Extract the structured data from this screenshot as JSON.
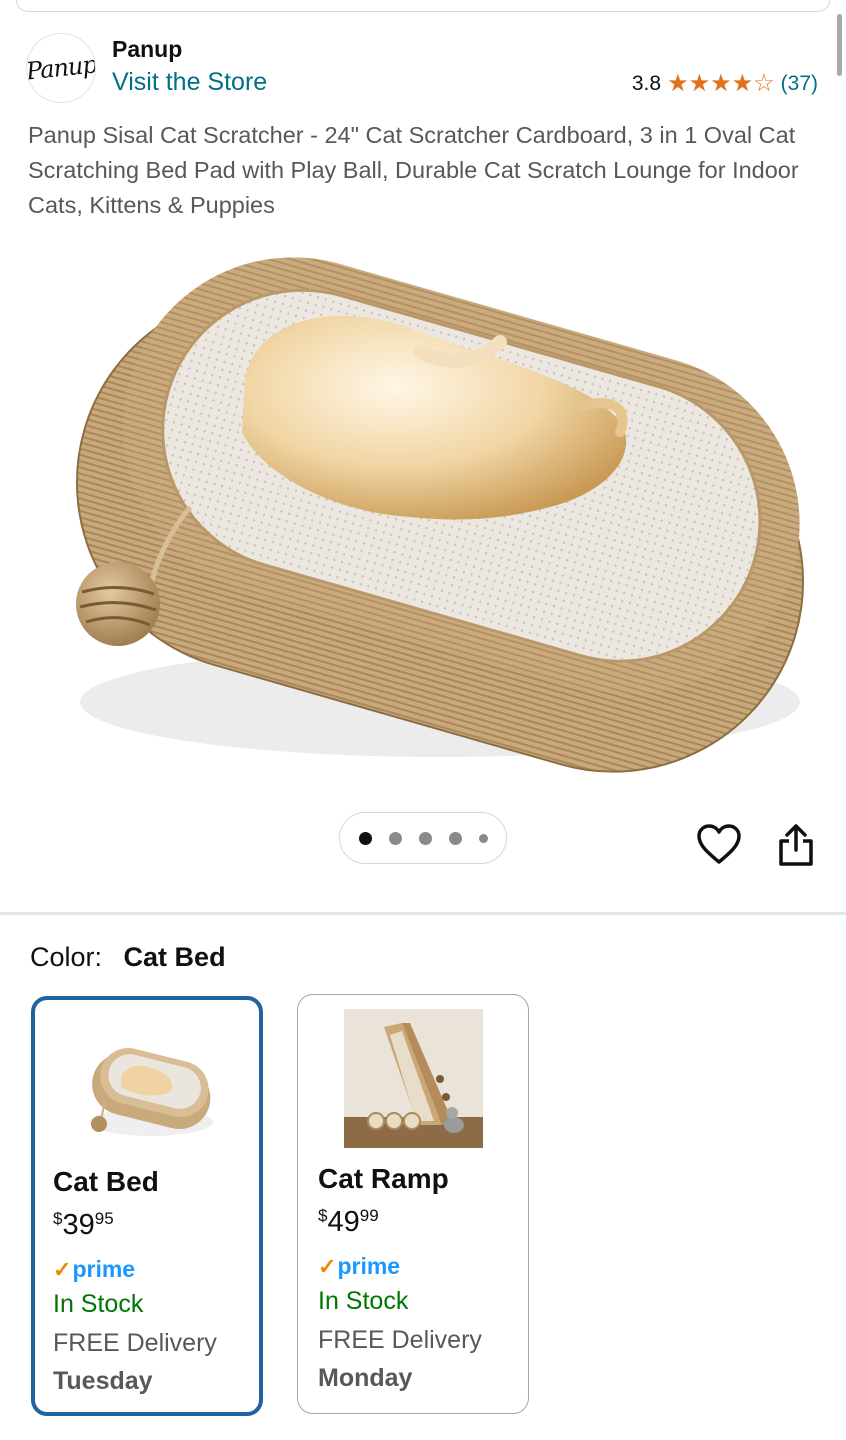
{
  "brand": {
    "logo_text": "Panup",
    "name": "Panup",
    "store_link": "Visit the Store"
  },
  "rating": {
    "value": "3.8",
    "stars": 3.8,
    "count": "(37)"
  },
  "product": {
    "title": "Panup Sisal Cat Scratcher - 24\" Cat Scratcher Cardboard, 3 in 1 Oval Cat Scratching Bed Pad with Play Ball, Durable Cat Scratch Lounge for Indoor Cats, Kittens & Puppies"
  },
  "gallery": {
    "image_count": 5,
    "active_index": 0
  },
  "actions": {
    "heart_icon": "heart-icon",
    "share_icon": "share-icon"
  },
  "variant": {
    "label": "Color:",
    "selected": "Cat Bed",
    "options": [
      {
        "name": "Cat Bed",
        "price_symbol": "$",
        "price_whole": "39",
        "price_cents": "95",
        "prime": "prime",
        "stock": "In Stock",
        "delivery": "FREE Delivery",
        "day": "Tuesday"
      },
      {
        "name": "Cat Ramp",
        "price_symbol": "$",
        "price_whole": "49",
        "price_cents": "99",
        "prime": "prime",
        "stock": "In Stock",
        "delivery": "FREE Delivery",
        "day": "Monday"
      }
    ]
  },
  "colors": {
    "link": "#007185",
    "star": "#e2711d",
    "stock": "#007600",
    "prime": "#1a98ff",
    "selected_border": "#2162a1"
  }
}
